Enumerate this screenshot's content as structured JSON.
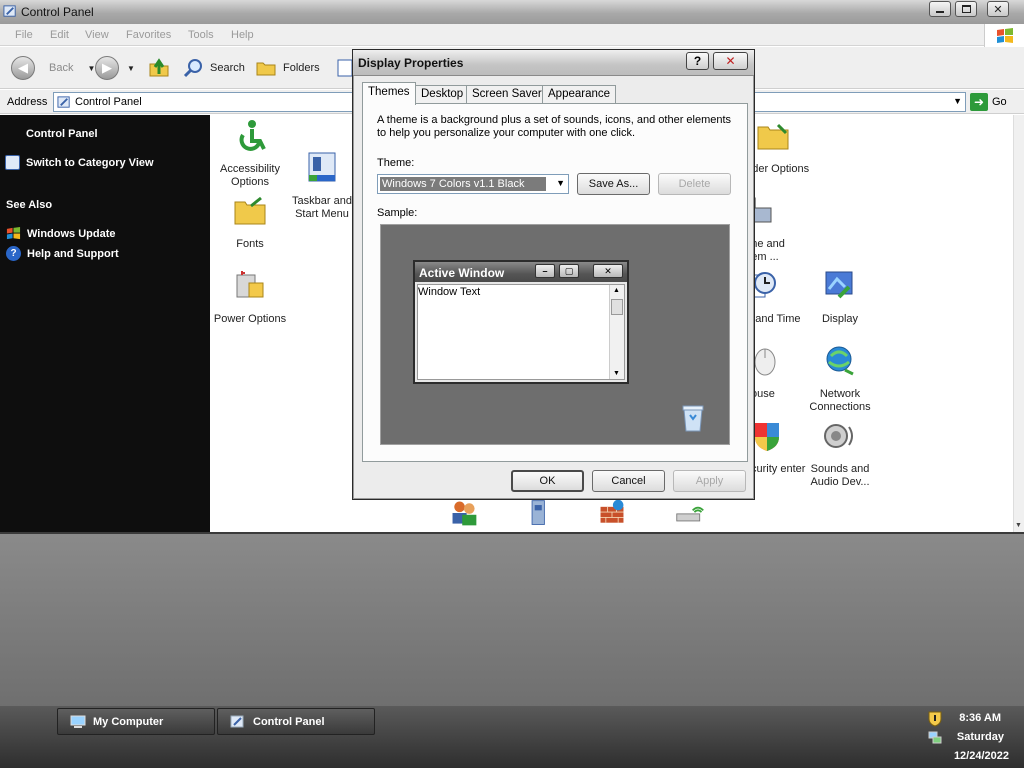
{
  "window": {
    "title": "Control Panel",
    "menu": [
      "File",
      "Edit",
      "View",
      "Favorites",
      "Tools",
      "Help"
    ],
    "toolbar": {
      "back": "Back",
      "search": "Search",
      "folders": "Folders"
    },
    "address": {
      "label": "Address",
      "value": "Control Panel",
      "go": "Go"
    }
  },
  "sidebar": {
    "heading": "Control Panel",
    "switch_view": "Switch to Category View",
    "see_also_heading": "See Also",
    "links": [
      "Windows Update",
      "Help and Support"
    ]
  },
  "items": [
    {
      "label": "Accessibility Options",
      "icon": "accessibility-icon"
    },
    {
      "label": "Taskbar and Start Menu",
      "icon": "taskbar-icon"
    },
    {
      "label": "Fonts",
      "icon": "fonts-folder-icon"
    },
    {
      "label": "Power Options",
      "icon": "power-icon"
    },
    {
      "label": "Folder Options",
      "icon": "folder-options-icon"
    },
    {
      "label": "hone and odem ...",
      "icon": "phone-modem-icon"
    },
    {
      "label": "te and Time",
      "icon": "date-time-icon"
    },
    {
      "label": "Display",
      "icon": "display-icon"
    },
    {
      "label": "ouse",
      "icon": "mouse-icon"
    },
    {
      "label": "Network Connections",
      "icon": "network-icon"
    },
    {
      "label": "curity enter",
      "icon": "security-center-icon"
    },
    {
      "label": "Sounds and Audio Dev...",
      "icon": "sounds-icon"
    }
  ],
  "dialog": {
    "title": "Display Properties",
    "help_glyph": "?",
    "close_glyph": "✕",
    "tabs": [
      "Themes",
      "Desktop",
      "Screen Saver",
      "Appearance"
    ],
    "active_tab": "Themes",
    "description": "A theme is a background plus a set of sounds, icons, and other elements to help you personalize your computer with one click.",
    "theme_label": "Theme:",
    "theme_value": "Windows 7 Colors v1.1 Black",
    "save_as": "Save As...",
    "delete": "Delete",
    "sample_label": "Sample:",
    "sample": {
      "window_title": "Active Window",
      "window_text": "Window Text"
    },
    "ok": "OK",
    "cancel": "Cancel",
    "apply": "Apply"
  },
  "taskbar": {
    "buttons": [
      "My Computer",
      "Control Panel"
    ],
    "clock": {
      "time": "8:36 AM",
      "day": "Saturday",
      "date": "12/24/2022"
    }
  },
  "colors": {
    "sidebar_bg": "#0e0e0e",
    "desktop": "#7a7a7a",
    "taskbar": "#3a3a3a",
    "go_green": "#2d9a3a"
  }
}
